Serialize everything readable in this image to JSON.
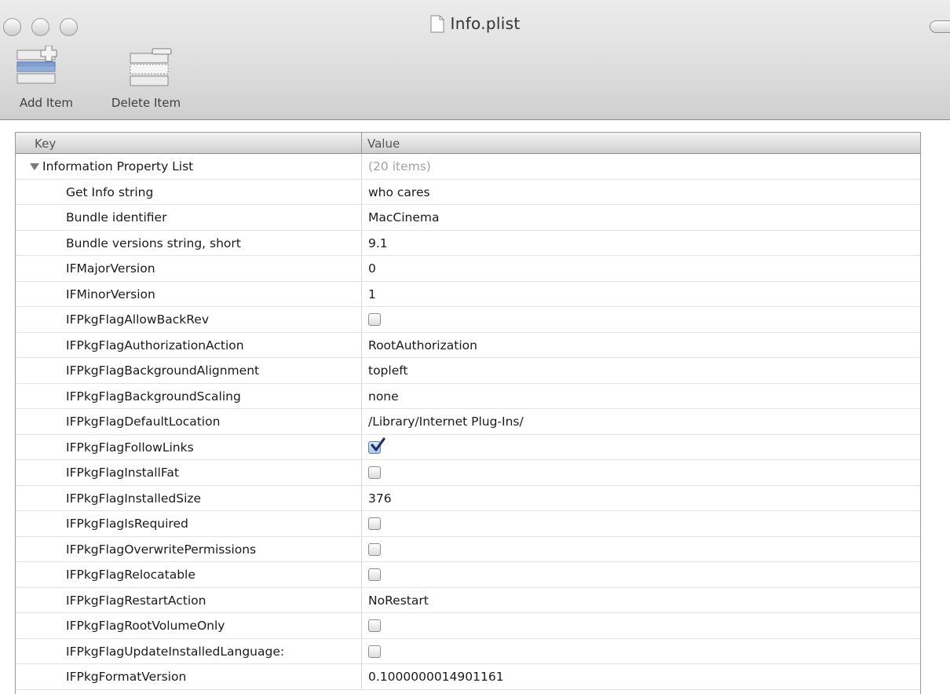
{
  "window": {
    "title": "Info.plist"
  },
  "toolbar": {
    "add_label": "Add Item",
    "delete_label": "Delete Item"
  },
  "table": {
    "columns": {
      "key": "Key",
      "value": "Value"
    },
    "root": {
      "key": "Information Property List",
      "value": "(20 items)"
    },
    "rows": [
      {
        "key": "Get Info string",
        "type": "text",
        "value": "who cares"
      },
      {
        "key": "Bundle identifier",
        "type": "text",
        "value": "MacCinema"
      },
      {
        "key": "Bundle versions string, short",
        "type": "text",
        "value": "9.1"
      },
      {
        "key": "IFMajorVersion",
        "type": "text",
        "value": "0"
      },
      {
        "key": "IFMinorVersion",
        "type": "text",
        "value": "1"
      },
      {
        "key": "IFPkgFlagAllowBackRev",
        "type": "bool",
        "checked": false
      },
      {
        "key": "IFPkgFlagAuthorizationAction",
        "type": "text",
        "value": "RootAuthorization"
      },
      {
        "key": "IFPkgFlagBackgroundAlignment",
        "type": "text",
        "value": "topleft"
      },
      {
        "key": "IFPkgFlagBackgroundScaling",
        "type": "text",
        "value": "none"
      },
      {
        "key": "IFPkgFlagDefaultLocation",
        "type": "text",
        "value": "/Library/Internet Plug-Ins/"
      },
      {
        "key": "IFPkgFlagFollowLinks",
        "type": "bool",
        "checked": true
      },
      {
        "key": "IFPkgFlagInstallFat",
        "type": "bool",
        "checked": false
      },
      {
        "key": "IFPkgFlagInstalledSize",
        "type": "text",
        "value": "376"
      },
      {
        "key": "IFPkgFlagIsRequired",
        "type": "bool",
        "checked": false
      },
      {
        "key": "IFPkgFlagOverwritePermissions",
        "type": "bool",
        "checked": false
      },
      {
        "key": "IFPkgFlagRelocatable",
        "type": "bool",
        "checked": false
      },
      {
        "key": "IFPkgFlagRestartAction",
        "type": "text",
        "value": "NoRestart"
      },
      {
        "key": "IFPkgFlagRootVolumeOnly",
        "type": "bool",
        "checked": false
      },
      {
        "key": "IFPkgFlagUpdateInstalledLanguage:",
        "type": "bool",
        "checked": false
      },
      {
        "key": "IFPkgFormatVersion",
        "type": "text",
        "value": "0.1000000014901161"
      }
    ]
  }
}
